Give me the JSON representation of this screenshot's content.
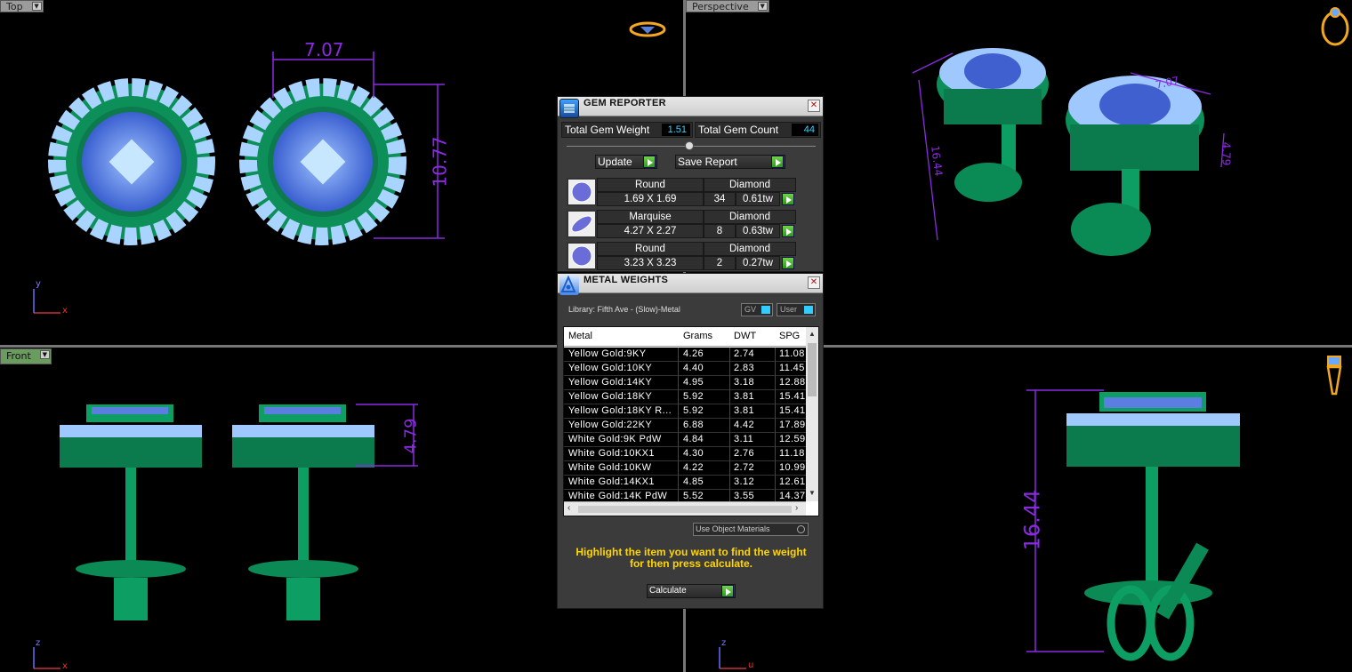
{
  "viewports": {
    "top": {
      "label": "Top",
      "dim_width": "7.07",
      "dim_height": "10.77"
    },
    "perspective": {
      "label": "Perspective",
      "dim_width": "7.07",
      "dim_height": "16.44",
      "dim_side": "4.79"
    },
    "front": {
      "label": "Front",
      "dim_height": "4.79"
    },
    "right": {
      "dim_height": "16.44"
    }
  },
  "axes": {
    "top": [
      "y",
      "x"
    ],
    "front": [
      "z",
      "x"
    ],
    "right": [
      "z",
      "u"
    ]
  },
  "gem_reporter": {
    "title": "GEM REPORTER",
    "total_weight_label": "Total Gem Weight",
    "total_weight_value": "1.51",
    "total_count_label": "Total Gem Count",
    "total_count_value": "44",
    "update_label": "Update",
    "save_report_label": "Save Report",
    "rows": [
      {
        "shape": "Round",
        "material": "Diamond",
        "size": "1.69 X 1.69",
        "count": "34",
        "weight": "0.61tw"
      },
      {
        "shape": "Marquise",
        "material": "Diamond",
        "size": "4.27 X 2.27",
        "count": "8",
        "weight": "0.63tw"
      },
      {
        "shape": "Round",
        "material": "Diamond",
        "size": "3.23 X 3.23",
        "count": "2",
        "weight": "0.27tw"
      }
    ]
  },
  "metal_weights": {
    "title": "METAL WEIGHTS",
    "library": "Library: Fifth Ave - (Slow)-Metal",
    "gv_label": "GV",
    "user_label": "User",
    "columns": [
      "Metal",
      "Grams",
      "DWT",
      "SPG"
    ],
    "rows": [
      [
        "Yellow Gold:9KY",
        "4.26",
        "2.74",
        "11.08"
      ],
      [
        "Yellow Gold:10KY",
        "4.40",
        "2.83",
        "11.45"
      ],
      [
        "Yellow Gold:14KY",
        "4.95",
        "3.18",
        "12.88"
      ],
      [
        "Yellow Gold:18KY",
        "5.92",
        "3.81",
        "15.41"
      ],
      [
        "Yellow Gold:18KY R...",
        "5.92",
        "3.81",
        "15.41"
      ],
      [
        "Yellow Gold:22KY",
        "6.88",
        "4.42",
        "17.89"
      ],
      [
        "White Gold:9K PdW",
        "4.84",
        "3.11",
        "12.59"
      ],
      [
        "White Gold:10KX1",
        "4.30",
        "2.76",
        "11.18"
      ],
      [
        "White Gold:10KW",
        "4.22",
        "2.72",
        "10.99"
      ],
      [
        "White Gold:14KX1",
        "4.85",
        "3.12",
        "12.61"
      ],
      [
        "White Gold:14K PdW",
        "5.52",
        "3.55",
        "14.37"
      ]
    ],
    "use_object_materials": "Use Object Materials",
    "hint": "Highlight the item you want to find the weight for then press calculate.",
    "calculate_label": "Calculate"
  },
  "colors": {
    "metal": "#0d9e63",
    "gem_light": "#9ec9ff",
    "gem_blue": "#4d6fd8",
    "dimension": "#8a2be2",
    "panel_bg": "#3b3b3b",
    "value_text": "#38d4ff",
    "hint": "#ffd600"
  },
  "icons": [
    "gem-reporter-icon",
    "metal-weights-icon",
    "ring-icon",
    "pendant-icon",
    "diamond-badge-icon"
  ]
}
